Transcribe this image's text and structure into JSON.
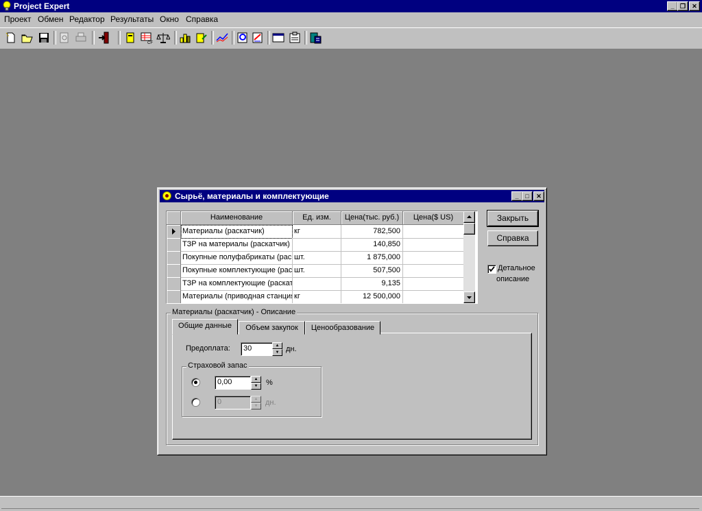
{
  "app": {
    "title": "Project Expert",
    "caption_buttons": [
      "_",
      "❐",
      "✕"
    ]
  },
  "menu": [
    {
      "label": "Проект"
    },
    {
      "label": "Обмен"
    },
    {
      "label": "Редактор"
    },
    {
      "label": "Результаты"
    },
    {
      "label": "Окно"
    },
    {
      "label": "Справка"
    }
  ],
  "toolbar": {
    "buttons": [
      "new-icon",
      "open-icon",
      "save-icon",
      "print-preview-icon",
      "print-icon",
      "exit-icon",
      "project-icon",
      "cashflow-icon",
      "balance-icon",
      "chart-icon",
      "report-icon",
      "line-chart-icon",
      "analysis-icon",
      "document-icon",
      "window-icon",
      "clipboard-icon",
      "calculator-icon"
    ]
  },
  "dialog": {
    "title": "Сырьё, материалы и комплектующие",
    "columns": [
      "Наименование",
      "Ед. изм.",
      "Цена(тыс. руб.)",
      "Цена($ US)"
    ],
    "rows": [
      {
        "name": "Материалы (раскатчик)",
        "unit": "кг",
        "price_rub": "782,500",
        "price_usd": ""
      },
      {
        "name": "ТЗР на материалы (раскатчик)",
        "unit": "",
        "price_rub": "140,850",
        "price_usd": ""
      },
      {
        "name": "Покупные полуфабрикаты (раскатчик)",
        "unit": "шт.",
        "price_rub": "1 875,000",
        "price_usd": ""
      },
      {
        "name": "Покупные комплектующие (раскатчик)",
        "unit": "шт.",
        "price_rub": "507,500",
        "price_usd": ""
      },
      {
        "name": "ТЗР на комплектующие (раскатчик)",
        "unit": "",
        "price_rub": "9,135",
        "price_usd": ""
      },
      {
        "name": "Материалы (приводная станция)",
        "unit": "кг",
        "price_rub": "12 500,000",
        "price_usd": ""
      }
    ],
    "close_button": "Закрыть",
    "help_button": "Справка",
    "detail_checkbox": {
      "label_line1": "Детальное",
      "label_line2": "описание",
      "checked": true
    },
    "description_group": "Материалы (раскатчик) - Описание",
    "tabs": [
      "Общие данные",
      "Объем закупок",
      "Ценообразование"
    ],
    "prepayment_label": "Предоплата:",
    "prepayment_value": "30",
    "prepayment_unit": "дн.",
    "reserve_group": "Страховой запас",
    "reserve_percent_value": "0,00",
    "reserve_percent_unit": "%",
    "reserve_days_value": "0",
    "reserve_days_unit": "дн."
  }
}
